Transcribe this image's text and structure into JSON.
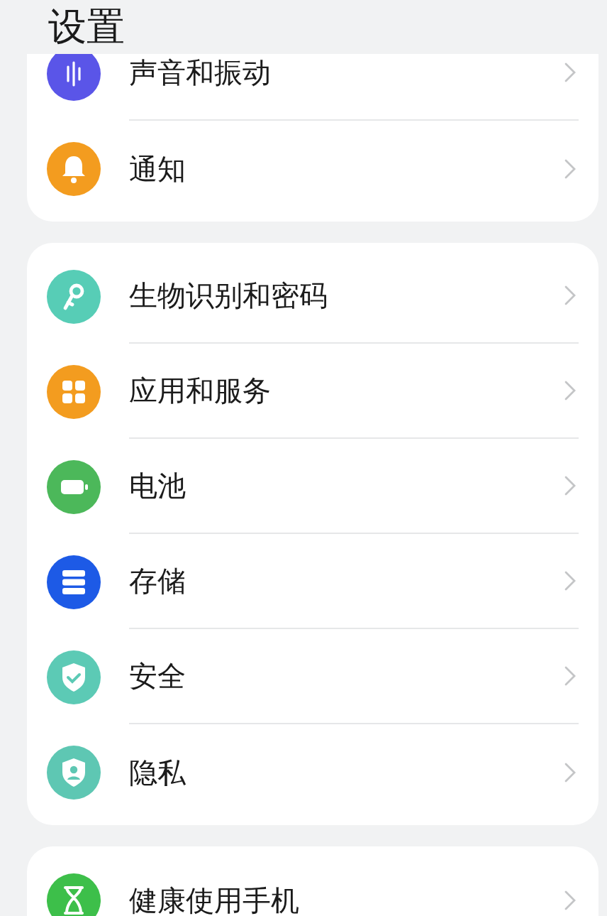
{
  "title": "设置",
  "groups": [
    {
      "items": [
        {
          "label": "声音和振动",
          "kind": "sound",
          "color": "#5a55e8"
        },
        {
          "label": "通知",
          "kind": "bell",
          "color": "#f39c1f"
        }
      ]
    },
    {
      "items": [
        {
          "label": "生物识别和密码",
          "kind": "key",
          "color": "#57cdb6"
        },
        {
          "label": "应用和服务",
          "kind": "apps",
          "color": "#f39c1f"
        },
        {
          "label": "电池",
          "kind": "battery",
          "color": "#4cb85a"
        },
        {
          "label": "存储",
          "kind": "storage",
          "color": "#1d5ae6"
        },
        {
          "label": "安全",
          "kind": "shield",
          "color": "#5ccab5"
        },
        {
          "label": "隐私",
          "kind": "privacy",
          "color": "#5ec7b3"
        }
      ]
    },
    {
      "items": [
        {
          "label": "健康使用手机",
          "kind": "hourglass",
          "color": "#3dbf4a"
        }
      ]
    }
  ]
}
